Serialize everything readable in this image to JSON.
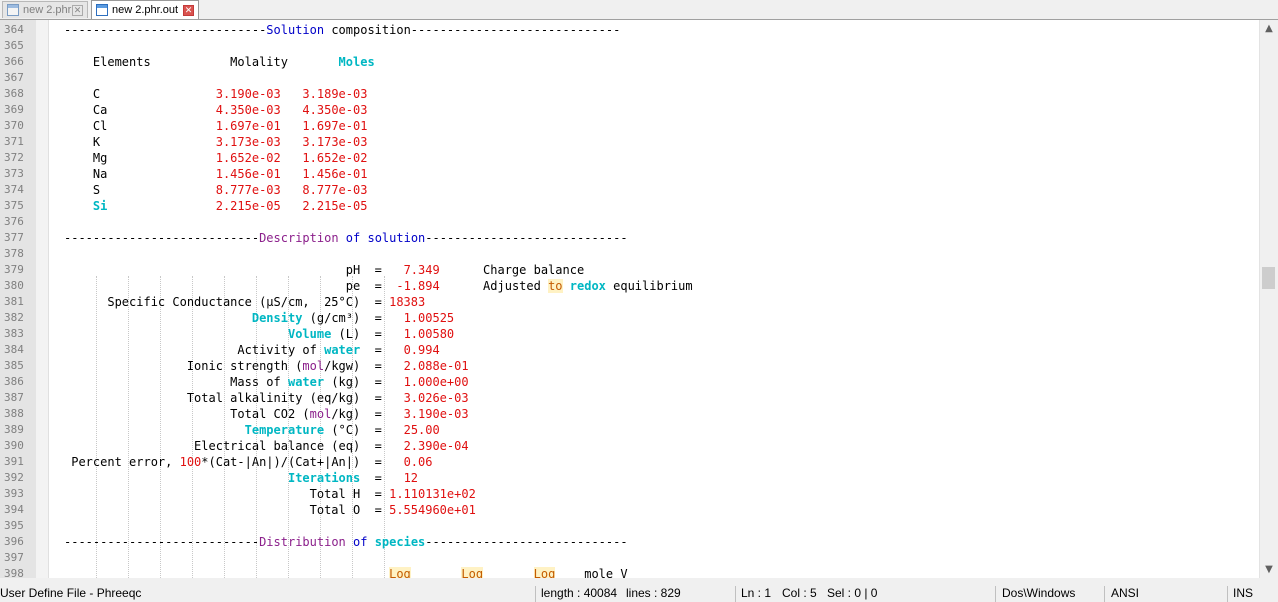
{
  "tabs": [
    {
      "label": "new  2.phr",
      "active": false
    },
    {
      "label": "new  2.phr.out",
      "active": true
    }
  ],
  "lines": [
    {
      "n": "364",
      "segs": [
        [
          "----------------------------",
          ""
        ],
        [
          "Solution",
          "blue"
        ],
        [
          " composition-----------------------------",
          ""
        ]
      ]
    },
    {
      "n": "365",
      "segs": []
    },
    {
      "n": "366",
      "segs": [
        [
          "    Elements           Molality       ",
          ""
        ],
        [
          "Moles",
          "cyan"
        ]
      ]
    },
    {
      "n": "367",
      "segs": []
    },
    {
      "n": "368",
      "segs": [
        [
          "    C                ",
          ""
        ],
        [
          "3.190e-03   3.189e-03",
          "red"
        ]
      ]
    },
    {
      "n": "369",
      "segs": [
        [
          "    Ca               ",
          ""
        ],
        [
          "4.350e-03   4.350e-03",
          "red"
        ]
      ]
    },
    {
      "n": "370",
      "segs": [
        [
          "    Cl               ",
          ""
        ],
        [
          "1.697e-01   1.697e-01",
          "red"
        ]
      ]
    },
    {
      "n": "371",
      "segs": [
        [
          "    K                ",
          ""
        ],
        [
          "3.173e-03   3.173e-03",
          "red"
        ]
      ]
    },
    {
      "n": "372",
      "segs": [
        [
          "    Mg               ",
          ""
        ],
        [
          "1.652e-02   1.652e-02",
          "red"
        ]
      ]
    },
    {
      "n": "373",
      "segs": [
        [
          "    Na               ",
          ""
        ],
        [
          "1.456e-01   1.456e-01",
          "red"
        ]
      ]
    },
    {
      "n": "374",
      "segs": [
        [
          "    S                ",
          ""
        ],
        [
          "8.777e-03   8.777e-03",
          "red"
        ]
      ]
    },
    {
      "n": "375",
      "segs": [
        [
          "    ",
          ""
        ],
        [
          "Si",
          "cyan"
        ],
        [
          "               ",
          ""
        ],
        [
          "2.215e-05   2.215e-05",
          "red"
        ]
      ]
    },
    {
      "n": "376",
      "segs": []
    },
    {
      "n": "377",
      "segs": [
        [
          "---------------------------",
          ""
        ],
        [
          "Description",
          "purple"
        ],
        [
          " ",
          ""
        ],
        [
          "of",
          "blue"
        ],
        [
          " ",
          ""
        ],
        [
          "solution",
          "blue"
        ],
        [
          "----------------------------",
          ""
        ]
      ]
    },
    {
      "n": "378",
      "segs": []
    },
    {
      "n": "379",
      "segs": [
        [
          "                                       pH  =   ",
          ""
        ],
        [
          "7.349",
          "red"
        ],
        [
          "      Charge balance",
          ""
        ]
      ]
    },
    {
      "n": "380",
      "segs": [
        [
          "                                       pe  =  ",
          ""
        ],
        [
          "-1.894",
          "red"
        ],
        [
          "      Adjusted ",
          ""
        ],
        [
          "to",
          "hl"
        ],
        [
          " ",
          ""
        ],
        [
          "redox",
          "cyan"
        ],
        [
          " equilibrium",
          ""
        ]
      ]
    },
    {
      "n": "381",
      "segs": [
        [
          "      Specific Conductance (µS/cm,  25°C)  = ",
          ""
        ],
        [
          "18383",
          "red"
        ]
      ]
    },
    {
      "n": "382",
      "segs": [
        [
          "                          ",
          ""
        ],
        [
          "Density",
          "cyan"
        ],
        [
          " (g/cm³)  =   ",
          ""
        ],
        [
          "1.00525",
          "red"
        ]
      ]
    },
    {
      "n": "383",
      "segs": [
        [
          "                               ",
          ""
        ],
        [
          "Volume",
          "cyan"
        ],
        [
          " (L)  =   ",
          ""
        ],
        [
          "1.00580",
          "red"
        ]
      ]
    },
    {
      "n": "384",
      "segs": [
        [
          "                        Activity of ",
          ""
        ],
        [
          "water",
          "cyan"
        ],
        [
          "  =   ",
          ""
        ],
        [
          "0.994",
          "red"
        ]
      ]
    },
    {
      "n": "385",
      "segs": [
        [
          "                 Ionic strength (",
          ""
        ],
        [
          "mol",
          "purple"
        ],
        [
          "/kgw)  =   ",
          ""
        ],
        [
          "2.088e-01",
          "red"
        ]
      ]
    },
    {
      "n": "386",
      "segs": [
        [
          "                       Mass of ",
          ""
        ],
        [
          "water",
          "cyan"
        ],
        [
          " (kg)  =   ",
          ""
        ],
        [
          "1.000e+00",
          "red"
        ]
      ]
    },
    {
      "n": "387",
      "segs": [
        [
          "                 Total alkalinity (eq/kg)  =   ",
          ""
        ],
        [
          "3.026e-03",
          "red"
        ]
      ]
    },
    {
      "n": "388",
      "segs": [
        [
          "                       Total CO2 (",
          ""
        ],
        [
          "mol",
          "purple"
        ],
        [
          "/kg)  =   ",
          ""
        ],
        [
          "3.190e-03",
          "red"
        ]
      ]
    },
    {
      "n": "389",
      "segs": [
        [
          "                         ",
          ""
        ],
        [
          "Temperature",
          "cyan"
        ],
        [
          " (°C)  =   ",
          ""
        ],
        [
          "25.00",
          "red"
        ]
      ]
    },
    {
      "n": "390",
      "segs": [
        [
          "                  Electrical balance (eq)  =   ",
          ""
        ],
        [
          "2.390e-04",
          "red"
        ]
      ]
    },
    {
      "n": "391",
      "segs": [
        [
          " Percent error, ",
          ""
        ],
        [
          "100",
          "red"
        ],
        [
          "*(Cat-|An|)/(Cat+|An|)  =   ",
          ""
        ],
        [
          "0.06",
          "red"
        ]
      ]
    },
    {
      "n": "392",
      "segs": [
        [
          "                               ",
          ""
        ],
        [
          "Iterations",
          "cyan"
        ],
        [
          "  =   ",
          ""
        ],
        [
          "12",
          "red"
        ]
      ]
    },
    {
      "n": "393",
      "segs": [
        [
          "                                  Total H  = ",
          ""
        ],
        [
          "1.110131e+02",
          "red"
        ]
      ]
    },
    {
      "n": "394",
      "segs": [
        [
          "                                  Total O  = ",
          ""
        ],
        [
          "5.554960e+01",
          "red"
        ]
      ]
    },
    {
      "n": "395",
      "segs": []
    },
    {
      "n": "396",
      "segs": [
        [
          "---------------------------",
          ""
        ],
        [
          "Distribution",
          "purple"
        ],
        [
          " ",
          ""
        ],
        [
          "of",
          "blue"
        ],
        [
          " ",
          ""
        ],
        [
          "species",
          "cyan"
        ],
        [
          "----------------------------",
          ""
        ]
      ]
    },
    {
      "n": "397",
      "segs": []
    },
    {
      "n": "398",
      "segs": [
        [
          "                                             ",
          ""
        ],
        [
          "Log",
          "hl"
        ],
        [
          "       ",
          ""
        ],
        [
          "Log",
          "hl"
        ],
        [
          "       ",
          ""
        ],
        [
          "Log",
          "hl"
        ],
        [
          "    mole V",
          ""
        ]
      ]
    }
  ],
  "status": {
    "filetype": "User Define File - Phreeqc",
    "length": "length : 40084",
    "lines": "lines : 829",
    "ln": "Ln : 1",
    "col": "Col : 5",
    "sel": "Sel : 0 | 0",
    "eol": "Dos\\Windows",
    "encoding": "ANSI",
    "mode": "INS"
  },
  "colors": {
    "red": "#e01010",
    "blue": "#0000c8",
    "cyan": "#00b7c3",
    "purple": "#8b1f8b"
  }
}
